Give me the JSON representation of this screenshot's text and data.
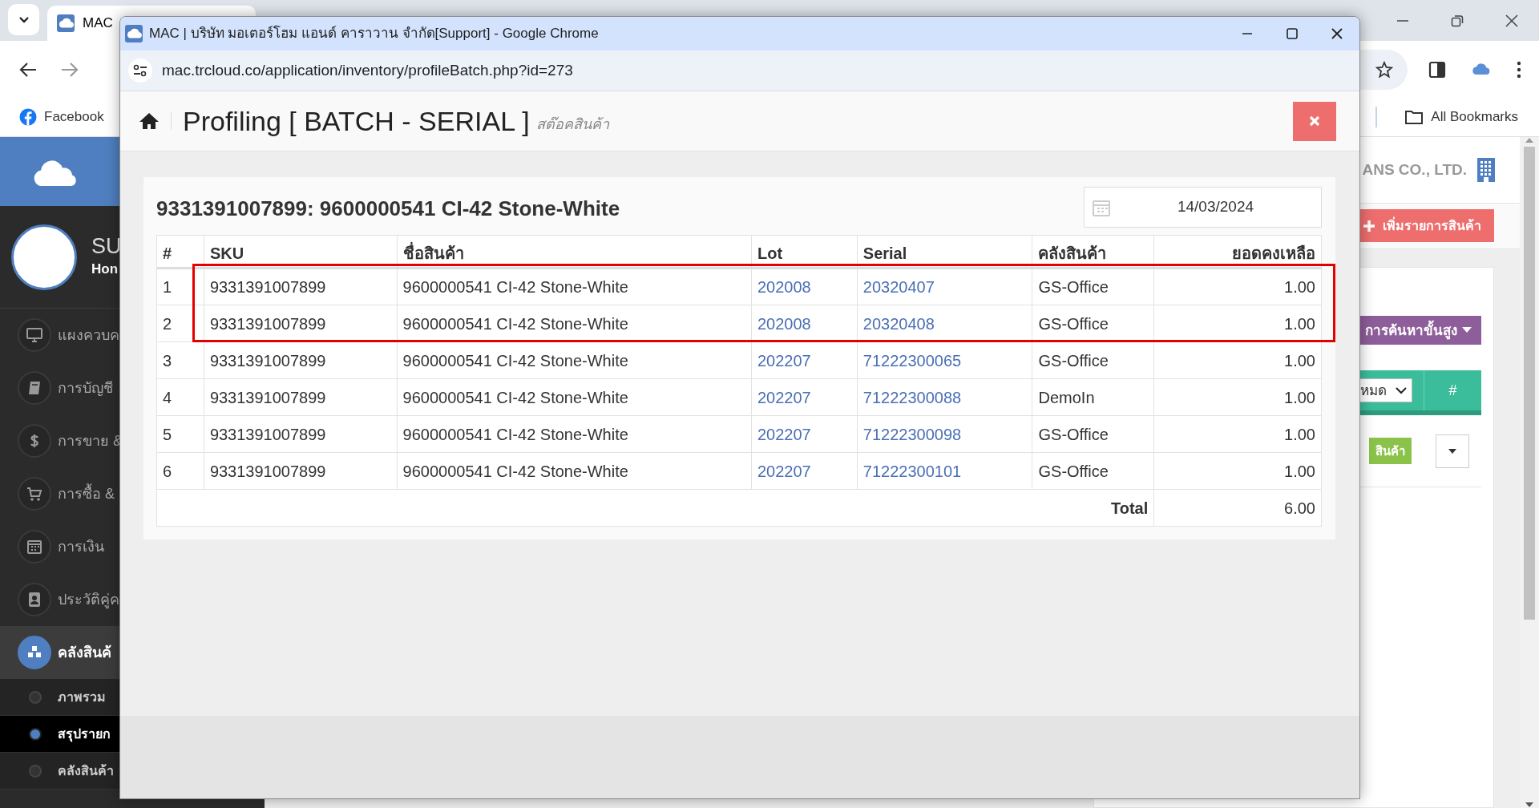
{
  "browser": {
    "tab_title": "MAC",
    "bookmarks": [
      {
        "label": "Facebook"
      }
    ],
    "all_bookmarks": "All Bookmarks"
  },
  "app": {
    "sidebar": {
      "user_name": "SU",
      "user_role": "Hon",
      "menu": [
        {
          "label": "แผงควบค",
          "selected": false
        },
        {
          "label": "การบัญชี",
          "selected": false
        },
        {
          "label": "การขาย &",
          "selected": false
        },
        {
          "label": "การซื้อ &",
          "selected": false
        },
        {
          "label": "การเงิน",
          "selected": false
        },
        {
          "label": "ประวัติคู่ค",
          "selected": false
        },
        {
          "label": "คลังสินค้",
          "selected": true,
          "children": [
            {
              "label": "ภาพรวม",
              "selected": false
            },
            {
              "label": "สรุปรายก",
              "selected": true
            },
            {
              "label": "คลังสินค้า",
              "selected": false
            }
          ]
        }
      ]
    },
    "company": "ANS CO., LTD.",
    "add_button": "เพิ่มรายการสินค้า",
    "advanced_search": "การค้นหาขั้นสูง",
    "filter_select": "หมด",
    "column_hash": "#",
    "row_button": "สินค้า"
  },
  "popup": {
    "window_title": "MAC | บริษัท มอเตอร์โฮม แอนด์ คาราวาน จำกัด[Support] - Google Chrome",
    "url": "mac.trcloud.co/application/inventory/profileBatch.php?id=273",
    "page_title": "Profiling [ BATCH - SERIAL ]",
    "page_subtitle": "สต๊อคสินค้า",
    "item_heading": "9331391007899: 9600000541 CI-42 Stone-White",
    "date": "14/03/2024",
    "table": {
      "columns": [
        {
          "label": "#",
          "kind": "text"
        },
        {
          "label": "SKU",
          "kind": "text"
        },
        {
          "label": "ชื่อสินค้า",
          "kind": "text"
        },
        {
          "label": "Lot",
          "kind": "link"
        },
        {
          "label": "Serial",
          "kind": "link"
        },
        {
          "label": "คลังสินค้า",
          "kind": "text"
        },
        {
          "label": "ยอดคงเหลือ",
          "kind": "number"
        }
      ],
      "rows": [
        {
          "marked": true,
          "cells": [
            "1",
            "9331391007899",
            "9600000541 CI-42 Stone-White",
            "202008",
            "20320407",
            "GS-Office",
            "1.00"
          ]
        },
        {
          "marked": true,
          "cells": [
            "2",
            "9331391007899",
            "9600000541 CI-42 Stone-White",
            "202008",
            "20320408",
            "GS-Office",
            "1.00"
          ]
        },
        {
          "marked": false,
          "cells": [
            "3",
            "9331391007899",
            "9600000541 CI-42 Stone-White",
            "202207",
            "71222300065",
            "GS-Office",
            "1.00"
          ]
        },
        {
          "marked": false,
          "cells": [
            "4",
            "9331391007899",
            "9600000541 CI-42 Stone-White",
            "202207",
            "71222300088",
            "DemoIn",
            "1.00"
          ]
        },
        {
          "marked": false,
          "cells": [
            "5",
            "9331391007899",
            "9600000541 CI-42 Stone-White",
            "202207",
            "71222300098",
            "GS-Office",
            "1.00"
          ]
        },
        {
          "marked": false,
          "cells": [
            "6",
            "9331391007899",
            "9600000541 CI-42 Stone-White",
            "202207",
            "71222300101",
            "GS-Office",
            "1.00"
          ]
        }
      ],
      "total_label": "Total",
      "total": "6.00"
    }
  }
}
